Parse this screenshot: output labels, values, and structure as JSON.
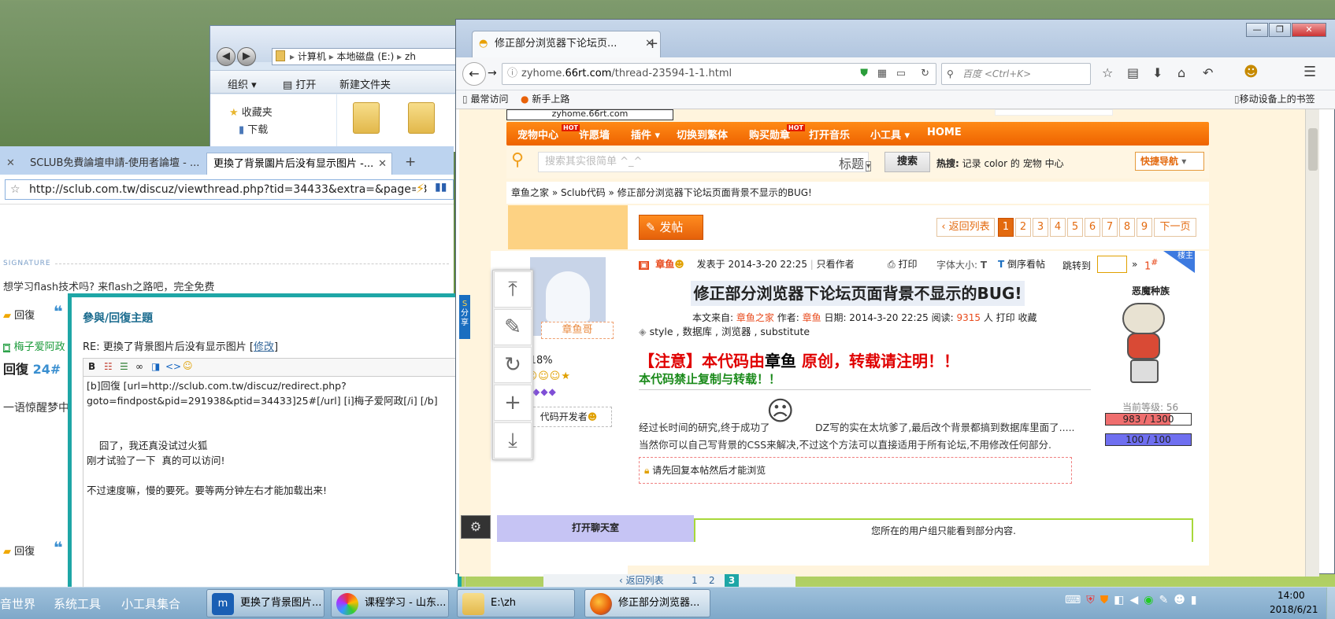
{
  "explorer": {
    "breadcrumb": [
      "计算机",
      "本地磁盘 (E:)",
      "zh"
    ],
    "commands": [
      "组织",
      "打开",
      "新建文件夹"
    ],
    "nav_items": [
      "收藏夹",
      "下载"
    ]
  },
  "left_browser": {
    "tabs": [
      "SCLUB免費論壇申請-使用者論壇 - ...",
      "更換了背景圖片后没有显示图片 -..."
    ],
    "url": "http://sclub.com.tw/discuz/viewthread.php?tid=34433&extra=&page=3",
    "signature_label": "SIGNATURE",
    "signature_text": "想学习flash技术吗? 来flash之路吧，完全免费",
    "reply_label": "回復",
    "user_name": "梅子爱阿政",
    "post_reply_floor": "回復",
    "floor_number": "24#",
    "quote_text": "一语惊醒梦中",
    "reply_label_2": "回復"
  },
  "reply_dialog": {
    "title": "參與/回復主題",
    "re_prefix": "RE: 更換了背景图片后没有显示图片 [",
    "re_link": "修改",
    "re_suffix": "]",
    "toolbar": [
      "B",
      "☷",
      "☰",
      "∞",
      "◨",
      "<>",
      "☺"
    ],
    "body": "[b]回復 [url=http://sclub.com.tw/discuz/redirect.php?\ngoto=findpost&pid=291938&ptid=34433]25#[/url] [i]梅子爱阿政[/i] [/b]\n\n\n    囧了，我还真没试过火狐\n刚才试验了一下  真的可以访问!\n\n不过速度嘛，慢的要死。要等两分钟左右才能加载出来!"
  },
  "firefox": {
    "tab_title": "修正部分浏览器下论坛页...",
    "url_prefix": "zyhome.",
    "url_domain": "66rt.com",
    "url_rest": "/thread-23594-1-1.html",
    "search_placeholder": "百度 <Ctrl+K>",
    "bookmarks": [
      "最常访问",
      "新手上路"
    ],
    "mobile_bookmarks": "移动设备上的书签",
    "window_controls": [
      "—",
      "❐",
      "✕"
    ]
  },
  "forum": {
    "site_banner": "zyhome.66rt.com",
    "nav": [
      {
        "label": "宠物中心",
        "hot": "HOT"
      },
      {
        "label": "许愿墙",
        "hot": ""
      },
      {
        "label": "插件 ▾",
        "hot": ""
      },
      {
        "label": "切换到繁体",
        "hot": ""
      },
      {
        "label": "购买勋章",
        "hot": "HOT"
      },
      {
        "label": "打开音乐",
        "hot": ""
      },
      {
        "label": "小工具 ▾",
        "hot": ""
      },
      {
        "label": "HOME",
        "hot": ""
      }
    ],
    "search_placeholder": "搜索其实很简单 ^_^",
    "search_type": "标题",
    "search_button": "搜索",
    "hot_label": "热搜:",
    "hot_terms": [
      "记录",
      "color",
      "的",
      "宠物",
      "中心"
    ],
    "quick_nav": "快捷导航",
    "breadcrumb": "章鱼之家 » Sclub代码 » 修正部分浏览器下论坛页面背景不显示的BUG!",
    "post_button": "发帖",
    "back_list": "返回列表",
    "pages": [
      "1",
      "2",
      "3",
      "4",
      "5",
      "6",
      "7",
      "8",
      "9"
    ],
    "next_page": "下一页",
    "author": "章鱼",
    "post_time": "发表于 2014-3-20 22:25",
    "only_author": "只看作者",
    "print": "打印",
    "font_size": "字体大小:",
    "font_t": "T",
    "reverse": "倒序看帖",
    "jump_to": "跳转到",
    "jump_arrow": "»",
    "floor": "1",
    "floor_mark": "#",
    "corner_label": "楼主",
    "post_title": "修正部分浏览器下论坛页面背景不显示的BUG!",
    "meta_from_label": "本文来自:",
    "meta_from": "章鱼之家",
    "meta_author_label": "作者:",
    "meta_author": "章鱼",
    "meta_date": "日期: 2014-3-20 22:25 阅读:",
    "meta_views": "9315",
    "meta_tail": "人 打印 收藏",
    "tags": [
      "style",
      "数据库",
      "浏览器",
      "substitute"
    ],
    "notice_1a": "【注意】本代码由",
    "notice_1b": "章鱼",
    "notice_1c": " 原创，转载请注明！！",
    "notice_2": "本代码禁止复制与转载！！",
    "body_1": "经过长时间的研究,终于成功了",
    "body_1b": "DZ写的实在太坑爹了,最后改个背景都搞到数据库里面了.....",
    "body_2": "当然你可以自己写背景的CSS来解决,不过这个方法可以直接适用于所有论坛,不用修改任何部分.",
    "reply_required": "请先回复本帖然后才能浏览",
    "avatar_name": "章鱼哥",
    "score": "18%",
    "score_label": "分:",
    "user_title": "代码开发者",
    "race": "恶魔种族",
    "level": "当前等级: 56",
    "hp": "983 / 1300",
    "mp": "100 / 100",
    "hp_fraction": 0.756,
    "mp_fraction": 1.0,
    "chatroom": "打开聊天室",
    "usergroup_note": "您所在的用户组只能看到部分内容.",
    "share": "分享",
    "bottom_back_list": "返回列表",
    "bottom_pages": [
      "1",
      "2",
      "3"
    ]
  },
  "taskbar": {
    "left_items": [
      "音世界",
      "系统工具",
      "小工具集合"
    ],
    "buttons": [
      "更换了背景图片...",
      "课程学习 - 山东...",
      "E:\\zh",
      "修正部分浏览器..."
    ],
    "time": "14:00",
    "date": "2018/6/21"
  }
}
